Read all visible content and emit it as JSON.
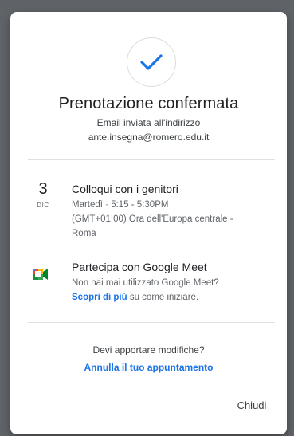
{
  "dialog": {
    "title": "Prenotazione confermata",
    "email_label": "Email inviata all'indirizzo",
    "email_address": "ante.insegna@romero.edu.it"
  },
  "event": {
    "day": "3",
    "month": "DIC",
    "title": "Colloqui con i genitori",
    "time": "Martedì · 5:15 - 5:30PM",
    "timezone_line1": "(GMT+01:00) Ora dell'Europa centrale -",
    "timezone_line2": "Roma"
  },
  "meet": {
    "title": "Partecipa con Google Meet",
    "question": "Non hai mai utilizzato Google Meet?",
    "learn_more_link": "Scopri di più",
    "learn_more_suffix": " su come iniziare."
  },
  "footer": {
    "changes_question": "Devi apportare modifiche?",
    "cancel_link": "Annulla il tuo appuntamento",
    "close_label": "Chiudi"
  },
  "colors": {
    "accent": "#1a73e8",
    "backdrop": "#5f6368"
  },
  "icons": {
    "confirmation": "check-icon",
    "meet": "google-meet-icon"
  }
}
